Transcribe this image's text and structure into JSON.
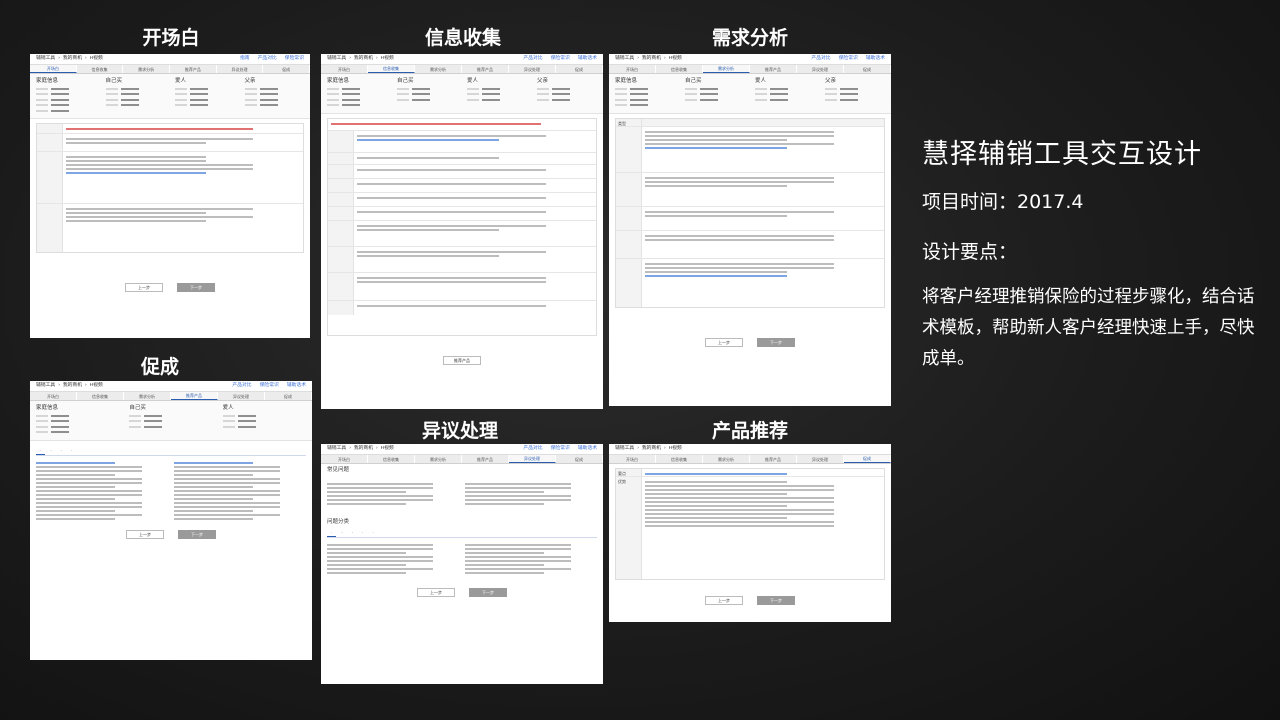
{
  "slide": {
    "title": "慧择辅销工具交互设计",
    "time": "项目时间：2017.4",
    "points": "设计要点：",
    "description": "将客户经理推销保险的过程步骤化，结合话术模板，帮助新人客户经理快速上手，尽快成单。"
  },
  "sections": {
    "opening": "开场白",
    "info": "信息收集",
    "needs": "需求分析",
    "promote": "促成",
    "objection": "异议处理",
    "recommend": "产品推荐"
  },
  "app": {
    "breadcrumb": [
      "辅销工具",
      "我的商机",
      "H视频"
    ],
    "links": [
      "指南",
      "产品对比",
      "保险常识",
      "辅助话术"
    ],
    "steps": [
      "开场白",
      "信息收集",
      "需求分析",
      "推荐产品",
      "异议处理",
      "促成"
    ],
    "family": {
      "title": "家庭信息",
      "self": "自己买",
      "spouse": "爱人",
      "father": "父亲"
    },
    "prev": "上一步",
    "next": "下一步",
    "generate": "推荐产品",
    "common_issues": "常见问题",
    "issue_category": "问题分类",
    "core_points": "要点",
    "remark": "优势",
    "type": "类型"
  }
}
